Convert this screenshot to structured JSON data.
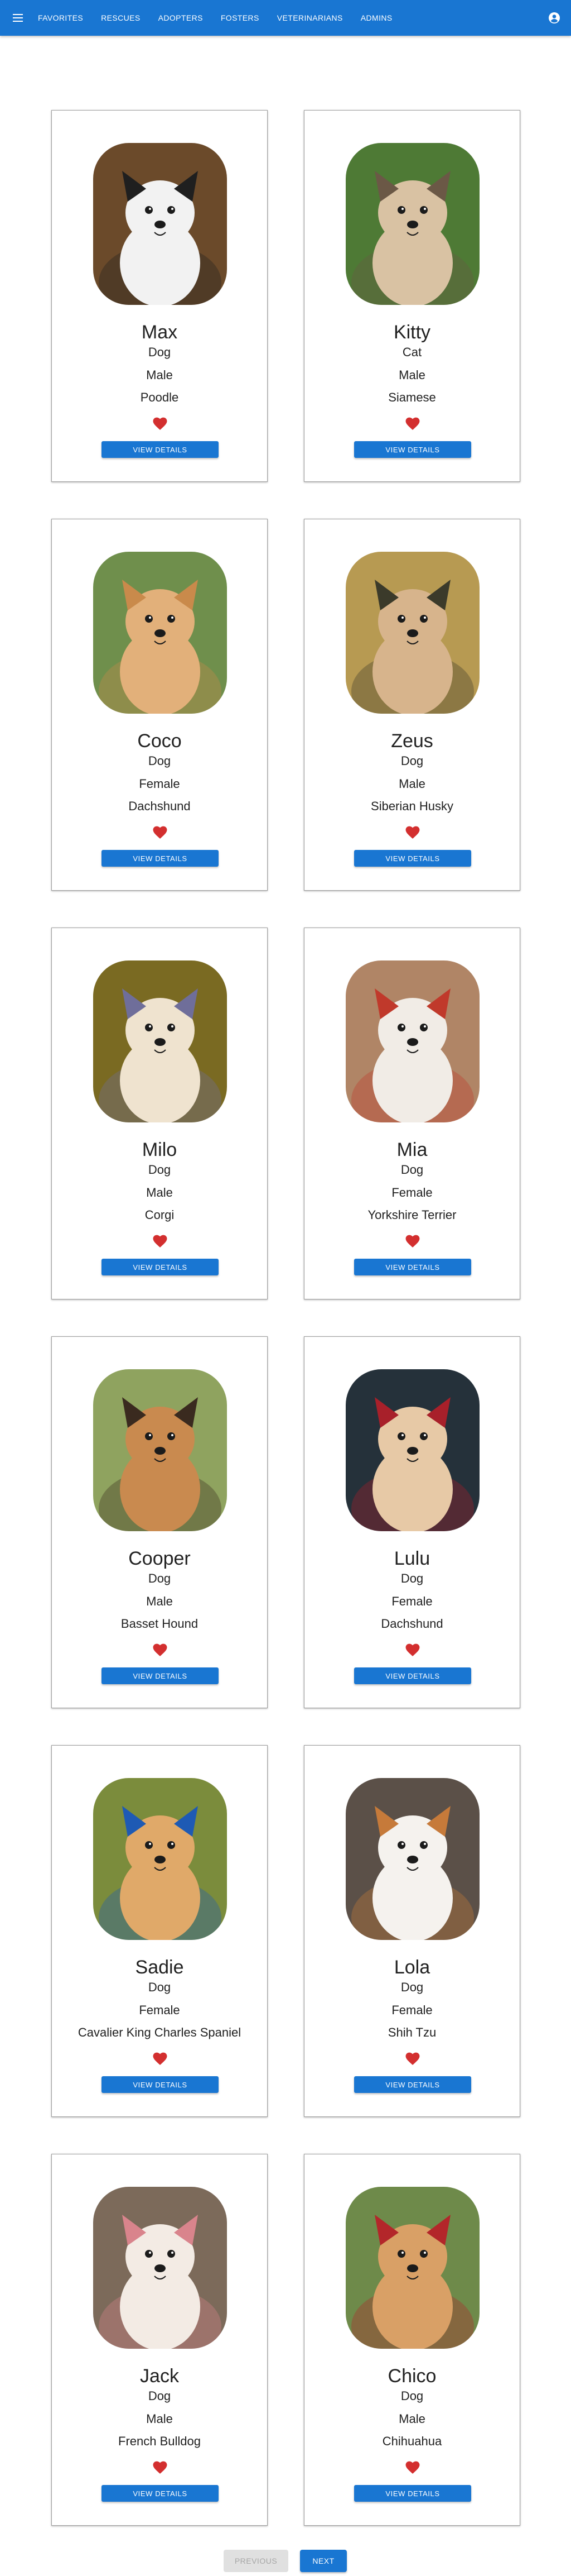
{
  "appbar": {
    "menu_icon": "hamburger-menu-icon",
    "nav": [
      "Favorites",
      "Rescues",
      "Adopters",
      "Fosters",
      "Veterinarians",
      "Admins"
    ],
    "account_icon": "account-circle-icon",
    "color": "#1976d2"
  },
  "pets": [
    {
      "name": "Max",
      "species": "Dog",
      "gender": "Male",
      "breed": "Poodle",
      "button": "View Details",
      "favorite_icon": "heart-icon",
      "photo": "husky-puppy-photo",
      "bg": "#6b4a2a",
      "fur": "#f2f2f2",
      "accent": "#1f1f1f"
    },
    {
      "name": "Kitty",
      "species": "Cat",
      "gender": "Male",
      "breed": "Siamese",
      "button": "View Details",
      "favorite_icon": "heart-icon",
      "photo": "tabby-kitten-photo",
      "bg": "#4e7a35",
      "fur": "#d9c2a3",
      "accent": "#6b5846"
    },
    {
      "name": "Coco",
      "species": "Dog",
      "gender": "Female",
      "breed": "Dachshund",
      "button": "View Details",
      "favorite_icon": "heart-icon",
      "photo": "fluffy-puppy-photo",
      "bg": "#6f8f4c",
      "fur": "#e2b07a",
      "accent": "#c98a4b"
    },
    {
      "name": "Zeus",
      "species": "Dog",
      "gender": "Male",
      "breed": "Siberian Husky",
      "button": "View Details",
      "favorite_icon": "heart-icon",
      "photo": "pug-puppy-photo",
      "bg": "#b79a52",
      "fur": "#d7b48c",
      "accent": "#3b3a2a"
    },
    {
      "name": "Milo",
      "species": "Dog",
      "gender": "Male",
      "breed": "Corgi",
      "button": "View Details",
      "favorite_icon": "heart-icon",
      "photo": "bowtie-puppy-photo",
      "bg": "#7a6a22",
      "fur": "#efe3cf",
      "accent": "#6f6e9a"
    },
    {
      "name": "Mia",
      "species": "Dog",
      "gender": "Female",
      "breed": "Yorkshire Terrier",
      "button": "View Details",
      "favorite_icon": "heart-icon",
      "photo": "bowtie-puppy-photo",
      "bg": "#b08566",
      "fur": "#f1ece6",
      "accent": "#c0392b"
    },
    {
      "name": "Cooper",
      "species": "Dog",
      "gender": "Male",
      "breed": "Basset Hound",
      "button": "View Details",
      "favorite_icon": "heart-icon",
      "photo": "running-puppy-photo",
      "bg": "#8fa35f",
      "fur": "#c98a4f",
      "accent": "#3a2a1f"
    },
    {
      "name": "Lulu",
      "species": "Dog",
      "gender": "Female",
      "breed": "Dachshund",
      "button": "View Details",
      "favorite_icon": "heart-icon",
      "photo": "sitting-puppy-photo",
      "bg": "#25313a",
      "fur": "#e7c9a6",
      "accent": "#a8202a"
    },
    {
      "name": "Sadie",
      "species": "Dog",
      "gender": "Female",
      "breed": "Cavalier King Charles Spaniel",
      "button": "View Details",
      "favorite_icon": "heart-icon",
      "photo": "pomeranian-puppy-photo",
      "bg": "#7b8c3c",
      "fur": "#e0a969",
      "accent": "#1e5ab4"
    },
    {
      "name": "Lola",
      "species": "Dog",
      "gender": "Female",
      "breed": "Shih Tzu",
      "button": "View Details",
      "favorite_icon": "heart-icon",
      "photo": "car-puppy-photo",
      "bg": "#5b5048",
      "fur": "#f5f2ee",
      "accent": "#c67a3a"
    },
    {
      "name": "Jack",
      "species": "Dog",
      "gender": "Male",
      "breed": "French Bulldog",
      "button": "View Details",
      "favorite_icon": "heart-icon",
      "photo": "bulldog-puppy-photo",
      "bg": "#7c6a5a",
      "fur": "#f3ebe4",
      "accent": "#d9848c"
    },
    {
      "name": "Chico",
      "species": "Dog",
      "gender": "Male",
      "breed": "Chihuahua",
      "button": "View Details",
      "favorite_icon": "heart-icon",
      "photo": "bowtie-puppy-photo",
      "bg": "#6e8a4a",
      "fur": "#d9a066",
      "accent": "#b3262a"
    }
  ],
  "pagination": {
    "previous": "Previous",
    "next": "Next",
    "previous_disabled": true
  }
}
